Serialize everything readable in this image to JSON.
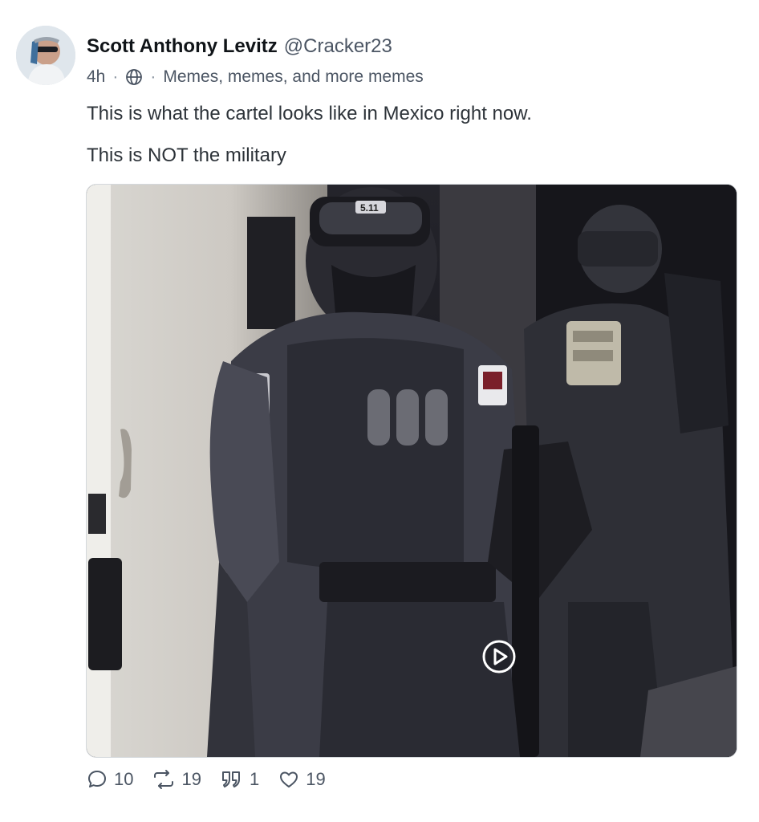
{
  "post": {
    "author": {
      "display_name": "Scott Anthony Levitz",
      "handle": "@Cracker23"
    },
    "meta": {
      "time": "4h",
      "separator": "·",
      "visibility_icon": "globe-icon",
      "group": "Memes, memes, and more memes"
    },
    "text_lines": [
      "This is what the cartel looks like in Mexico right now.",
      "This is NOT the military"
    ],
    "media": {
      "type": "video",
      "play_icon": "play-icon",
      "overlay_text": "5.11"
    },
    "actions": {
      "replies": {
        "icon": "comment-icon",
        "count": "10"
      },
      "reposts": {
        "icon": "repost-icon",
        "count": "19"
      },
      "quotes": {
        "icon": "quote-icon",
        "count": "1"
      },
      "likes": {
        "icon": "heart-icon",
        "count": "19"
      }
    }
  },
  "colors": {
    "text_primary": "#101418",
    "text_secondary": "#4b5563",
    "media_background": "#2c2b33"
  }
}
